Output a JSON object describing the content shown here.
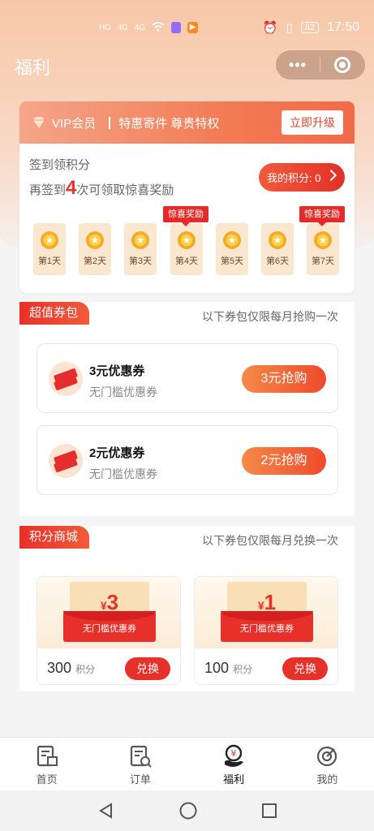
{
  "status_bar": {
    "signal_left": "HD",
    "signal_right": "HD",
    "network_1": "4G",
    "network_2": "4G",
    "battery": "82",
    "time": "17:50"
  },
  "nav": {
    "title": "福利"
  },
  "vip": {
    "label": "VIP会员",
    "slogan": "特惠寄件 尊贵特权",
    "upgrade": "立即升级"
  },
  "checkin": {
    "title": "签到领积分",
    "sub_prefix": "再签到",
    "days_left": "4",
    "sub_suffix": "次可领取惊喜奖励",
    "points_label": "我的积分: 0",
    "days": [
      {
        "label": "第1天",
        "reward": ""
      },
      {
        "label": "第2天",
        "reward": ""
      },
      {
        "label": "第3天",
        "reward": ""
      },
      {
        "label": "第4天",
        "reward": "惊喜奖励"
      },
      {
        "label": "第5天",
        "reward": ""
      },
      {
        "label": "第6天",
        "reward": ""
      },
      {
        "label": "第7天",
        "reward": "惊喜奖励"
      }
    ]
  },
  "value_pack": {
    "tag": "超值券包",
    "note": "以下券包仅限每月抢购一次",
    "coupons": [
      {
        "name": "3元优惠券",
        "desc": "无门槛优惠券",
        "button": "3元抢购"
      },
      {
        "name": "2元优惠券",
        "desc": "无门槛优惠券",
        "button": "2元抢购"
      }
    ]
  },
  "points_mall": {
    "tag": "积分商城",
    "note": "以下券包仅限每月兑换一次",
    "items": [
      {
        "currency": "¥",
        "amount": "3",
        "envelope": "无门槛优惠券",
        "points": "300",
        "points_unit": "积分",
        "button": "兑换"
      },
      {
        "currency": "¥",
        "amount": "1",
        "envelope": "无门槛优惠券",
        "points": "100",
        "points_unit": "积分",
        "button": "兑换"
      }
    ]
  },
  "tabbar": {
    "tabs": [
      {
        "label": "首页",
        "icon": "home-icon"
      },
      {
        "label": "订单",
        "icon": "order-icon"
      },
      {
        "label": "福利",
        "icon": "welfare-icon"
      },
      {
        "label": "我的",
        "icon": "profile-icon"
      }
    ],
    "active": "福利"
  },
  "colors": {
    "accent": "#e8302a",
    "banner": "#f27c55",
    "day_bg": "#fbe7cf"
  }
}
